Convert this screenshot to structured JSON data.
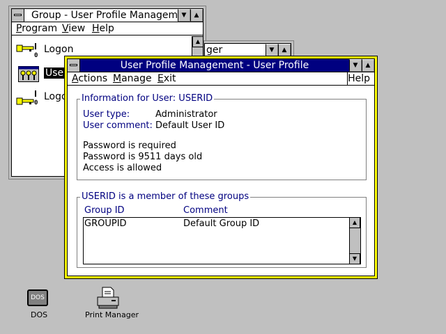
{
  "group_window": {
    "title": "Group - User Profile Manageme",
    "menu": [
      {
        "label_u": "P",
        "label_rest": "rogram"
      },
      {
        "label_u": "V",
        "label_rest": "iew"
      },
      {
        "label_u": "H",
        "label_rest": "elp"
      }
    ],
    "items": [
      {
        "label": "Logon",
        "icon": "key-logon-icon"
      },
      {
        "label": "User",
        "icon": "users-icon",
        "selected": true
      },
      {
        "label": "Logof",
        "icon": "key-logoff-icon"
      }
    ]
  },
  "back_window": {
    "title_fragment": "ger"
  },
  "profile_window": {
    "title": "User Profile Management - User Profile",
    "menu": {
      "actions": {
        "u": "A",
        "rest": "ctions"
      },
      "manage": {
        "u": "M",
        "rest": "anage"
      },
      "exit": {
        "u": "E",
        "rest": "xit"
      },
      "help": "Help"
    },
    "info": {
      "title": "Information for User:  USERID",
      "user_type_label": "User type:",
      "user_type_value": "Administrator",
      "user_comment_label": "User comment:",
      "user_comment_value": "Default User ID",
      "line1": "Password is required",
      "line2": "Password is 9511 days old",
      "line3": "Access is allowed"
    },
    "groups": {
      "title": "USERID is a member of these groups",
      "col_group_id": "Group ID",
      "col_comment": "Comment",
      "rows": [
        {
          "group_id": "GROUPID",
          "comment": "Default Group ID"
        }
      ]
    }
  },
  "desktop": {
    "icons": [
      {
        "label": "DOS",
        "badge": "DOS",
        "icon": "dos-icon"
      },
      {
        "label": "Print Manager",
        "icon": "printer-icon"
      }
    ]
  },
  "colors": {
    "desktop": "#c0c0c0",
    "active_title": "#000080",
    "inactive_title": "#ffffff",
    "active_frame": "#ffff00",
    "group_label": "#000080"
  }
}
